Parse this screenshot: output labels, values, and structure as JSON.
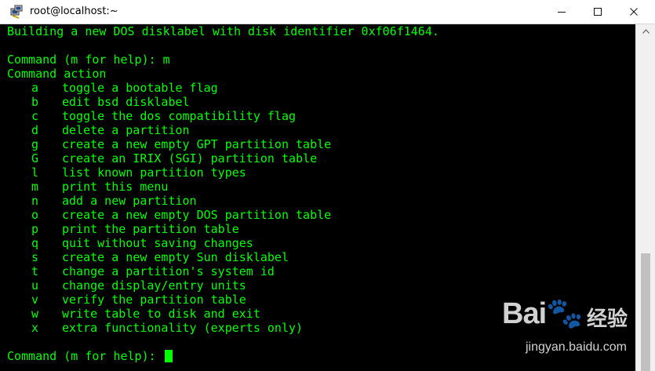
{
  "window": {
    "title": "root@localhost:~",
    "controls": {
      "minimize": "—",
      "maximize": "☐",
      "close": "✕"
    }
  },
  "terminal": {
    "intro_line": "Building a new DOS disklabel with disk identifier 0xf06f1464.",
    "first_prompt": "Command (m for help): m",
    "action_header": "Command action",
    "commands": [
      {
        "key": "a",
        "desc": "toggle a bootable flag"
      },
      {
        "key": "b",
        "desc": "edit bsd disklabel"
      },
      {
        "key": "c",
        "desc": "toggle the dos compatibility flag"
      },
      {
        "key": "d",
        "desc": "delete a partition"
      },
      {
        "key": "g",
        "desc": "create a new empty GPT partition table"
      },
      {
        "key": "G",
        "desc": "create an IRIX (SGI) partition table"
      },
      {
        "key": "l",
        "desc": "list known partition types"
      },
      {
        "key": "m",
        "desc": "print this menu"
      },
      {
        "key": "n",
        "desc": "add a new partition"
      },
      {
        "key": "o",
        "desc": "create a new empty DOS partition table"
      },
      {
        "key": "p",
        "desc": "print the partition table"
      },
      {
        "key": "q",
        "desc": "quit without saving changes"
      },
      {
        "key": "s",
        "desc": "create a new empty Sun disklabel"
      },
      {
        "key": "t",
        "desc": "change a partition's system id"
      },
      {
        "key": "u",
        "desc": "change display/entry units"
      },
      {
        "key": "v",
        "desc": "verify the partition table"
      },
      {
        "key": "w",
        "desc": "write table to disk and exit"
      },
      {
        "key": "x",
        "desc": "extra functionality (experts only)"
      }
    ],
    "final_prompt": "Command (m for help): ",
    "colors": {
      "background": "#000000",
      "text": "#00ff00"
    }
  },
  "watermark": {
    "logo": "Bai🐾",
    "cn": "经验",
    "url": "jingyan.baidu.com"
  }
}
